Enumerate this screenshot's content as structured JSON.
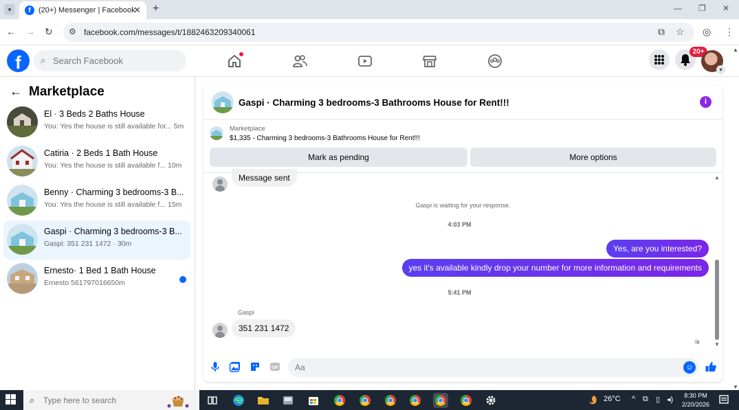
{
  "browser": {
    "tab_title": "(20+) Messenger | Facebook",
    "url": "facebook.com/messages/t/1882463209340061"
  },
  "fb": {
    "logo_letter": "f",
    "search_placeholder": "Search Facebook",
    "notification_badge": "20+"
  },
  "sidebar": {
    "title": "Marketplace",
    "conversations": [
      {
        "name": "El · 3 Beds 2 Baths House",
        "snippet": "You: Yes the house is still available for...",
        "time": "5m",
        "unread": false,
        "active": false
      },
      {
        "name": "Catiria · 2 Beds 1 Bath House",
        "snippet": "You: Yes the house is still available f...",
        "time": "10m",
        "unread": false,
        "active": false
      },
      {
        "name": "Benny · Charming 3 bedrooms-3 B...",
        "snippet": "You: Yes the house is still available f...",
        "time": "15m",
        "unread": false,
        "active": false
      },
      {
        "name": "Gaspi · Charming 3 bedrooms-3 B...",
        "snippet": "Gaspi: 351 231 1472",
        "time": "30m",
        "unread": false,
        "active": true
      },
      {
        "name": "Ernesto· 1 Bed 1 Bath House",
        "snippet": "Ernesto 5617970166",
        "time": "50m",
        "unread": true,
        "active": false
      }
    ]
  },
  "chat": {
    "title": "Gaspi · Charming 3 bedrooms-3 Bathrooms House for Rent!!!",
    "listing_label": "Marketplace",
    "listing_detail": "$1,335 - Charming 3 bedrooms-3 Bathrooms House for Rent!!!",
    "mark_pending_label": "Mark as pending",
    "more_options_label": "More options",
    "msg_sent": "Message sent",
    "waiting_text": "Gaspi is waiting for your response.",
    "time_1": "4:03 PM",
    "out_1": "Yes, are you interested?",
    "out_2": "yes it's available kindly drop your number for more information and requirements",
    "time_2": "5:41 PM",
    "sender": "Gaspi",
    "in_last": "351 231 1472",
    "composer_placeholder": "Aa"
  },
  "taskbar": {
    "search_placeholder": "Type here to search",
    "weather": "26°C",
    "time": "8:30 PM",
    "date": "2/20/2026"
  },
  "colors": {
    "fb_blue": "#0866ff",
    "outgoing_bubble": "#6b2ee6",
    "active_conv_bg": "#ebf5ff"
  }
}
